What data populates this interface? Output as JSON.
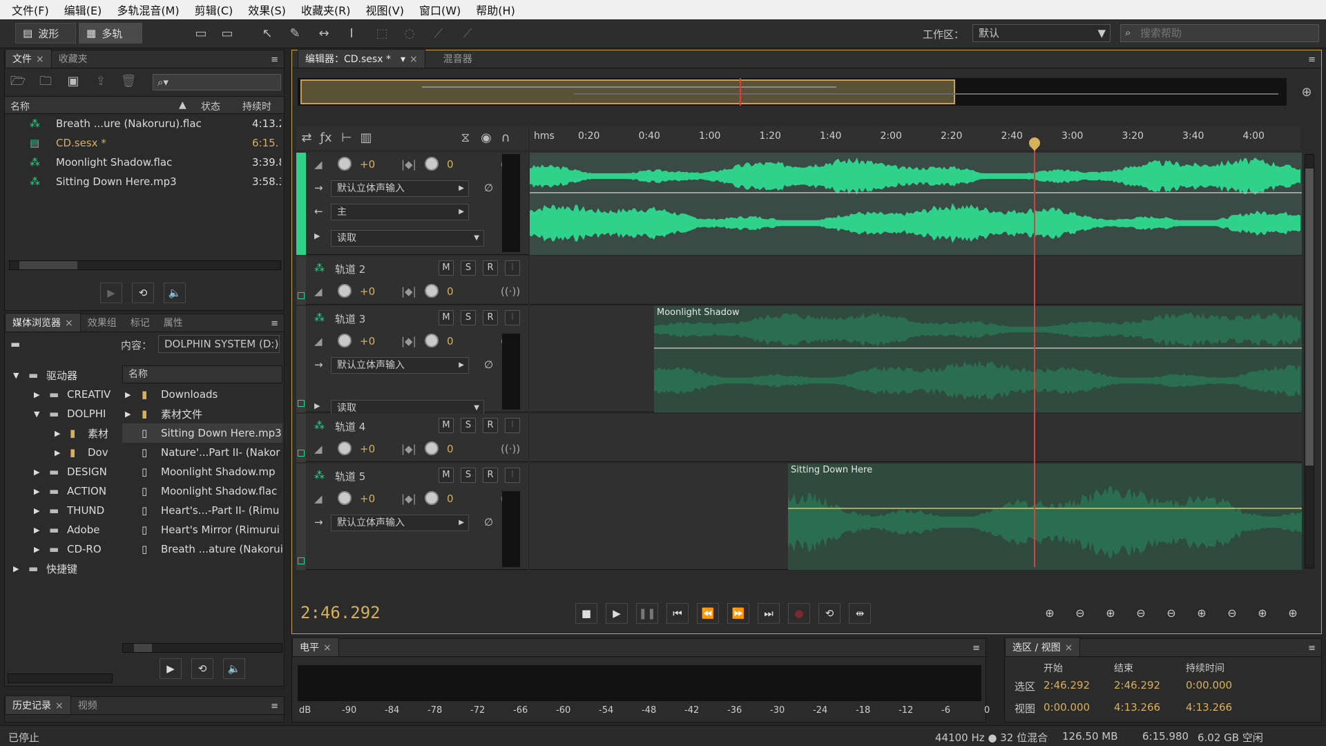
{
  "menu": [
    "文件(F)",
    "编辑(E)",
    "多轨混音(M)",
    "剪辑(C)",
    "效果(S)",
    "收藏夹(R)",
    "视图(V)",
    "窗口(W)",
    "帮助(H)"
  ],
  "toolbar": {
    "waveform_label": "波形",
    "multitrack_label": "多轨",
    "workspace_label": "工作区：",
    "workspace_value": "默认",
    "search_placeholder": "搜索帮助"
  },
  "files_panel": {
    "tabs": [
      "文件",
      "收藏夹"
    ],
    "columns": [
      "名称",
      "状态",
      "持续时"
    ],
    "items": [
      {
        "name": "Breath ...ure (Nakoruru).flac",
        "duration": "4:13.2",
        "selected": false
      },
      {
        "name": "CD.sesx *",
        "duration": "6:15.",
        "selected": true
      },
      {
        "name": "Moonlight Shadow.flac",
        "duration": "3:39.8",
        "selected": false
      },
      {
        "name": "Sitting Down Here.mp3",
        "duration": "3:58.3",
        "selected": false
      }
    ]
  },
  "media_panel": {
    "tabs": [
      "媒体浏览器",
      "效果组",
      "标记",
      "属性"
    ],
    "content_label": "内容：",
    "content_value": "DOLPHIN SYSTEM (D:)",
    "tree": [
      {
        "label": "驱动器",
        "level": 0,
        "arrow": "▼"
      },
      {
        "label": "CREATIV",
        "level": 1,
        "arrow": "▶"
      },
      {
        "label": "DOLPHI",
        "level": 1,
        "arrow": "▼"
      },
      {
        "label": "素材",
        "level": 2,
        "arrow": "▶"
      },
      {
        "label": "Dov",
        "level": 2,
        "arrow": "▶"
      },
      {
        "label": "DESIGN",
        "level": 1,
        "arrow": "▶"
      },
      {
        "label": "ACTION",
        "level": 1,
        "arrow": "▶"
      },
      {
        "label": "THUND",
        "level": 1,
        "arrow": "▶"
      },
      {
        "label": "Adobe",
        "level": 1,
        "arrow": "▶"
      },
      {
        "label": "CD-RO",
        "level": 1,
        "arrow": "▶"
      },
      {
        "label": "快捷键",
        "level": 0,
        "arrow": "▶"
      }
    ],
    "name_header": "名称",
    "files": [
      {
        "name": "Downloads",
        "kind": "folder"
      },
      {
        "name": "素材文件",
        "kind": "folder"
      },
      {
        "name": "Sitting Down Here.mp3",
        "kind": "audio"
      },
      {
        "name": "Nature'...Part II- (Nakor",
        "kind": "audio"
      },
      {
        "name": "Moonlight Shadow.mp",
        "kind": "audio"
      },
      {
        "name": "Moonlight Shadow.flac",
        "kind": "audio"
      },
      {
        "name": "Heart's...-Part II- (Rimu",
        "kind": "audio"
      },
      {
        "name": "Heart's Mirror (Rimurui",
        "kind": "audio"
      },
      {
        "name": "Breath ...ature (Nakorui",
        "kind": "audio"
      }
    ]
  },
  "history_panel": {
    "tabs": [
      "历史记录",
      "视频"
    ]
  },
  "editor": {
    "tab_label": "编辑器：CD.sesx *",
    "mixer_tab": "混音器",
    "time_unit": "hms",
    "ruler": [
      "0:20",
      "0:40",
      "1:00",
      "1:20",
      "1:40",
      "2:00",
      "2:20",
      "2:40",
      "3:00",
      "3:20",
      "3:40",
      "4:00"
    ],
    "current_time": "2:46.292"
  },
  "tracks": [
    {
      "name": "",
      "vol": "+0",
      "pan": "0",
      "input": "默认立体声输入",
      "output": "主",
      "mode": "读取"
    },
    {
      "name": "轨道 2",
      "vol": "+0",
      "pan": "0"
    },
    {
      "name": "轨道 3",
      "vol": "+0",
      "pan": "0",
      "input": "默认立体声输入",
      "mode": "读取",
      "clip": "Moonlight Shadow"
    },
    {
      "name": "轨道 4",
      "vol": "+0",
      "pan": "0"
    },
    {
      "name": "轨道 5",
      "vol": "+0",
      "pan": "0",
      "input": "默认立体声输入",
      "clip": "Sitting Down Here"
    }
  ],
  "msr": {
    "m": "M",
    "s": "S",
    "r": "R"
  },
  "levels_panel": {
    "tab": "电平",
    "scale": [
      "dB",
      "-90",
      "-84",
      "-78",
      "-72",
      "-66",
      "-60",
      "-54",
      "-48",
      "-42",
      "-36",
      "-30",
      "-24",
      "-18",
      "-12",
      "-6",
      "0"
    ]
  },
  "selection_panel": {
    "tab": "选区 / 视图",
    "headers": [
      "开始",
      "结束",
      "持续时间"
    ],
    "rows": [
      {
        "label": "选区",
        "start": "2:46.292",
        "end": "2:46.292",
        "duration": "0:00.000"
      },
      {
        "label": "视图",
        "start": "0:00.000",
        "end": "4:13.266",
        "duration": "4:13.266"
      }
    ]
  },
  "status": {
    "state": "已停止",
    "sample": "44100 Hz ● 32 位混合",
    "mem": "126.50 MB",
    "length": "6:15.980",
    "disk": "6.02 GB 空闲"
  },
  "colors": {
    "accent": "#d6b15c",
    "wave": "#2fd28a",
    "wave_dim": "#2b6e4f",
    "playhead": "#e23c3c"
  }
}
